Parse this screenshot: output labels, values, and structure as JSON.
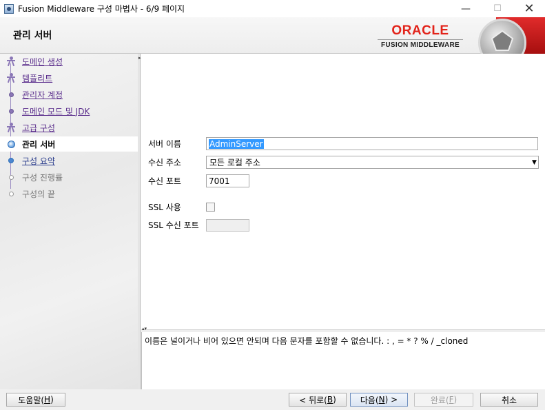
{
  "window": {
    "title": "Fusion Middleware 구성 마법사 - 6/9 페이지",
    "minimize": "—",
    "maximize": "☐",
    "close": "✕"
  },
  "header": {
    "heading": "관리 서버",
    "brand_top": "ORACLE",
    "brand_bottom": "FUSION MIDDLEWARE",
    "brand_color": "#e2231a"
  },
  "steps": [
    {
      "label": "도메인 생성",
      "state": "done-person"
    },
    {
      "label": "템플리트",
      "state": "done-person"
    },
    {
      "label": "관리자 계정",
      "state": "done"
    },
    {
      "label": "도메인 모드 및 JDK",
      "state": "done"
    },
    {
      "label": "고급 구성",
      "state": "done-person"
    },
    {
      "label": "관리 서버",
      "state": "active"
    },
    {
      "label": "구성 요약",
      "state": "next"
    },
    {
      "label": "구성 진행률",
      "state": "future"
    },
    {
      "label": "구성의 끝",
      "state": "future"
    }
  ],
  "form": {
    "server_name_label": "서버 이름",
    "server_name_value": "AdminServer",
    "listen_address_label": "수신 주소",
    "listen_address_value": "모든 로컬 주소",
    "listen_port_label": "수신 포트",
    "listen_port_value": "7001",
    "ssl_enable_label": "SSL 사용",
    "ssl_enabled": false,
    "ssl_port_label": "SSL 수신 포트",
    "ssl_port_value": ""
  },
  "message": "이름은 널이거나 비어 있으면 안되며 다음 문자를 포함할 수 없습니다. : , = * ? % / _cloned",
  "footer": {
    "help": {
      "text": "도움말(",
      "mnemonic": "H",
      "suffix": ")"
    },
    "back": {
      "text": "< 뒤로(",
      "mnemonic": "B",
      "suffix": ")"
    },
    "next": {
      "text": "다음(",
      "mnemonic": "N",
      "suffix": ") >"
    },
    "finish": {
      "text": "완료(",
      "mnemonic": "F",
      "suffix": ")"
    },
    "cancel": "취소"
  }
}
